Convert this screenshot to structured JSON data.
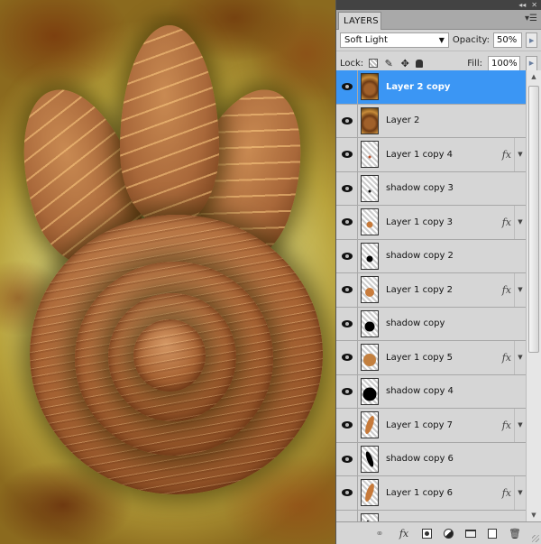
{
  "panel": {
    "title_tab": "LAYERS",
    "top_controls": {
      "collapse_icon": "double-chevron-left-icon",
      "close_icon": "close-icon"
    },
    "menu_icon": "panel-menu-icon",
    "blend_mode": {
      "selected": "Soft Light"
    },
    "opacity": {
      "label": "Opacity:",
      "value": "50%"
    },
    "lock": {
      "label": "Lock:",
      "icons": [
        "lock-transparent-pixels-icon",
        "lock-image-pixels-icon",
        "lock-position-icon",
        "lock-all-icon"
      ]
    },
    "fill": {
      "label": "Fill:",
      "value": "100%"
    }
  },
  "layers": [
    {
      "name": "Layer 2 copy",
      "selected": true,
      "fx": false,
      "thumb": "artwork"
    },
    {
      "name": "Layer 2",
      "selected": false,
      "fx": false,
      "thumb": "artwork"
    },
    {
      "name": "Layer 1 copy 4",
      "selected": false,
      "fx": true,
      "thumb": "tiny-orange"
    },
    {
      "name": "shadow copy 3",
      "selected": false,
      "fx": false,
      "thumb": "tiny-black-dot"
    },
    {
      "name": "Layer 1 copy 3",
      "selected": false,
      "fx": true,
      "thumb": "small-orange"
    },
    {
      "name": "shadow copy 2",
      "selected": false,
      "fx": false,
      "thumb": "small-black-dot"
    },
    {
      "name": "Layer 1 copy 2",
      "selected": false,
      "fx": true,
      "thumb": "medium-orange"
    },
    {
      "name": "shadow copy",
      "selected": false,
      "fx": false,
      "thumb": "medium-black-dot"
    },
    {
      "name": "Layer 1 copy 5",
      "selected": false,
      "fx": true,
      "thumb": "large-orange"
    },
    {
      "name": "shadow copy 4",
      "selected": false,
      "fx": false,
      "thumb": "large-black-dot"
    },
    {
      "name": "Layer 1 copy 7",
      "selected": false,
      "fx": true,
      "thumb": "petal-orange"
    },
    {
      "name": "shadow copy 6",
      "selected": false,
      "fx": false,
      "thumb": "petal-black"
    },
    {
      "name": "Layer 1 copy 6",
      "selected": false,
      "fx": true,
      "thumb": "petal-orange"
    },
    {
      "name": "",
      "selected": false,
      "fx": false,
      "thumb": "petal-black-partial"
    }
  ],
  "fx_label": "fx",
  "bottom_bar": {
    "icons": [
      "link-layers-icon",
      "add-layer-style-icon",
      "add-layer-mask-icon",
      "new-adjustment-layer-icon",
      "new-group-icon",
      "new-layer-icon",
      "delete-layer-icon"
    ],
    "fx_label": "fx"
  },
  "colors": {
    "selection": "#3b96f4",
    "panel_bg": "#d6d6d6",
    "artwork_wood": "#a86434",
    "artwork_background": "#d7d27a"
  }
}
